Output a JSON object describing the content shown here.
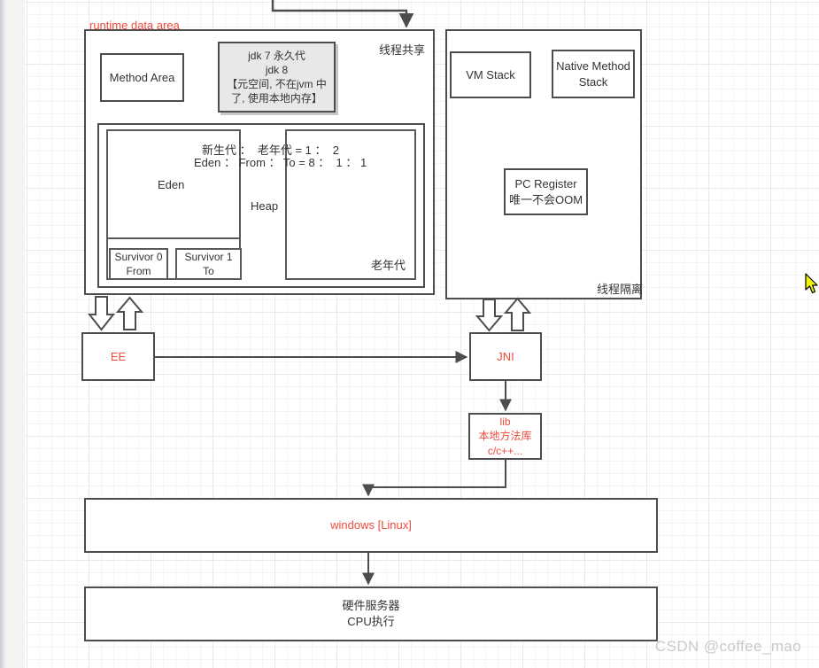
{
  "diagram": {
    "title_label": "runtime data area",
    "watermark": "CSDN @coffee_mao",
    "colors": {
      "accent_red": "#f04a3c",
      "stroke": "#4d4d4d",
      "text": "#333333",
      "metaspace_fill": "#e8e8e8",
      "grid": "#e9e9e9"
    }
  },
  "runtime_data_area": {
    "shared_panel": {
      "corner_label": "线程共享",
      "method_area": "Method Area",
      "metaspace": "jdk 7 永久代\njdk 8\n【元空间, 不在jvm 中\n了, 使用本地内存】",
      "heap": {
        "label": "Heap",
        "ratio_line_1": "新生代 ：  老年代 = 1 ：  2",
        "ratio_line_2": "Eden ： From ： To = 8 ：  1 ： 1",
        "eden": "Eden",
        "survivor_0": "Survivor 0\nFrom",
        "survivor_1": "Survivor 1\nTo",
        "old_generation": "老年代"
      }
    },
    "isolated_panel": {
      "corner_label": "线程隔离",
      "vm_stack": "VM Stack",
      "native_method_stack": "Native Method\nStack",
      "pc_register": "PC Register\n唯一不会OOM"
    }
  },
  "lower": {
    "ee": "EE",
    "jni": "JNI",
    "lib": "lib\n本地方法库\nc/c++...",
    "os": "windows [Linux]",
    "hardware": "硬件服务器\nCPU执行"
  }
}
